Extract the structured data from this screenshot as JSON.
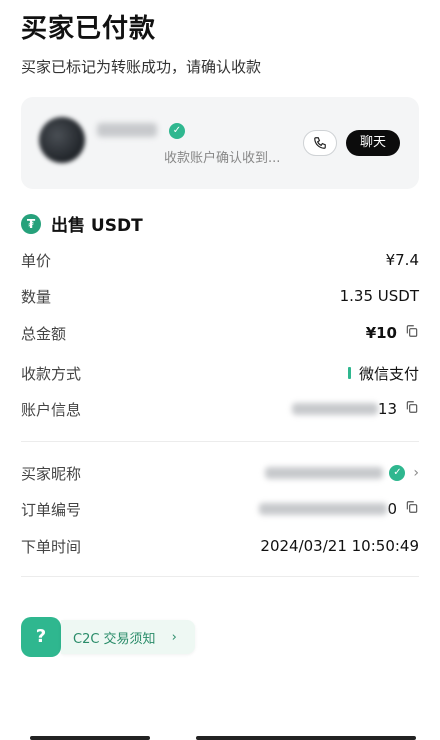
{
  "header": {
    "title": "买家已付款",
    "subtitle": "买家已标记为转账成功，请确认收款"
  },
  "seller_card": {
    "hint": "收款账户确认收到...",
    "chat_label": "聊天",
    "phone_icon": "phone-icon",
    "verified_icon": "verified-badge-icon"
  },
  "order": {
    "side_title": "出售 USDT",
    "coin_icon": "tether-icon",
    "rows": [
      {
        "label": "单价",
        "value": "¥7.4"
      },
      {
        "label": "数量",
        "value": "1.35 USDT"
      },
      {
        "label": "总金额",
        "value": "¥10"
      },
      {
        "label": "收款方式",
        "value": "微信支付"
      },
      {
        "label": "账户信息",
        "value": "13"
      }
    ],
    "rows2": [
      {
        "label": "买家昵称",
        "value": ""
      },
      {
        "label": "订单编号",
        "value": "0"
      },
      {
        "label": "下单时间",
        "value": "2024/03/21 10:50:49"
      }
    ]
  },
  "notice": {
    "icon": "?",
    "label": "C2C 交易须知",
    "chevron": "›"
  },
  "colors": {
    "accent": "#2fb78f",
    "chat_bg": "#0c0c0c",
    "card_bg": "#f4f5f6"
  }
}
